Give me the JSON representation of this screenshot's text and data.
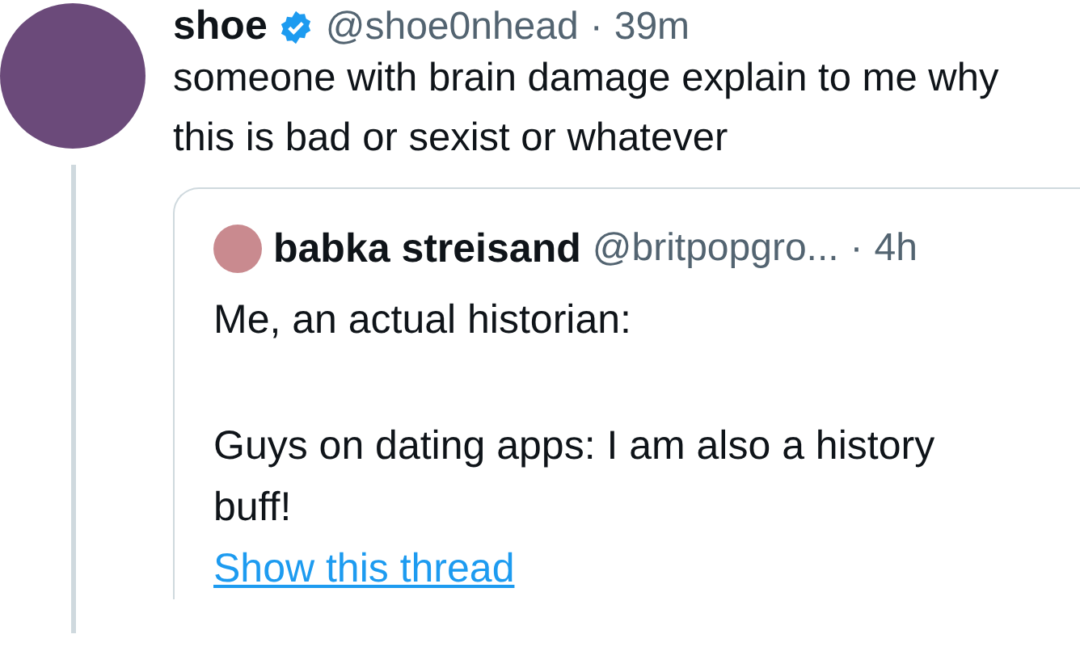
{
  "tweet": {
    "name": "shoe",
    "verified": true,
    "handle": "@shoe0nhead",
    "separator": "·",
    "time": "39m",
    "text": "someone with brain damage explain to me why this is bad or sexist or whatever",
    "quote": {
      "name": "babka streisand",
      "handle": "@britpopgro...",
      "separator": "·",
      "time": "4h",
      "paragraphs": [
        "Me, an actual historian:",
        "Guys on dating apps: I am also a history buff!"
      ],
      "link": "Show this thread"
    }
  }
}
